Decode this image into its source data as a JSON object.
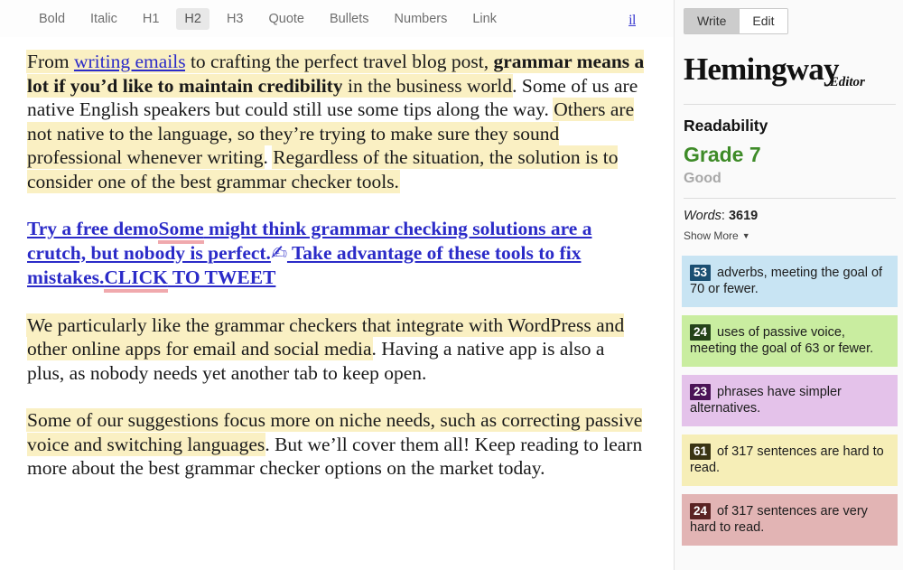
{
  "toolbar": {
    "items": [
      {
        "label": "Bold",
        "active": false
      },
      {
        "label": "Italic",
        "active": false
      },
      {
        "label": "H1",
        "active": false
      },
      {
        "label": "H2",
        "active": true
      },
      {
        "label": "H3",
        "active": false
      },
      {
        "label": "Quote",
        "active": false
      },
      {
        "label": "Bullets",
        "active": false
      },
      {
        "label": "Numbers",
        "active": false
      },
      {
        "label": "Link",
        "active": false
      }
    ],
    "chart_icon_label": "il"
  },
  "document": {
    "paragraph1": {
      "seg1": "From ",
      "link": "writing emails",
      "seg2": " to crafting the perfect travel blog post, ",
      "bold": "grammar means a lot if you’d like to maintain credibility",
      "seg3": " in the business world",
      "seg4": ". Some of us are native English speakers but could still use some tips along the way. ",
      "seg5": "Others are not native to the language, so they’re trying to make sure they sound professional whenever writing",
      "seg6": ". ",
      "seg7": "Regardless of the situation, the solution is to consider one of the best grammar checker tools.",
      "seg8": ""
    },
    "paragraph2": {
      "seg1": "Try a free demo",
      "seg2": "Some",
      "seg3": " might think grammar checking solutions are a crutch, but nobody is perfect.",
      "emoji": "✍",
      "seg4": " Take advantage of these tools to fix mistakes.",
      "seg5": "CLICK",
      "seg6": " TO TWEET"
    },
    "paragraph3": {
      "hl": "We particularly like the grammar checkers that integrate with WordPress and other online apps for email and social media",
      "rest": ". Having a native app is also a plus, as nobody needs yet another tab to keep open."
    },
    "paragraph4": {
      "hl": "Some of our suggestions focus more on niche needs, such as correcting passive voice and switching languages",
      "rest": ". But we’ll cover them all! Keep reading to learn more about the best grammar checker options on the market today."
    }
  },
  "sidebar": {
    "mode": {
      "write_label": "Write",
      "edit_label": "Edit",
      "selected": "Write"
    },
    "brand": {
      "name": "Hemingway",
      "sub": "Editor"
    },
    "readability": {
      "title": "Readability",
      "grade": "Grade 7",
      "note": "Good",
      "grade_color": "#3e8b28"
    },
    "words": {
      "label": "Words",
      "separator": ": ",
      "value": "3619"
    },
    "show_more": {
      "label": "Show More",
      "caret": "▼"
    },
    "stats": [
      {
        "count": "53",
        "text": " adverbs, meeting the goal of 70 or fewer.",
        "bg": "#c8e4f3",
        "badge_bg": "#1b4f72"
      },
      {
        "count": "24",
        "text": " uses of passive voice, meeting the goal of 63 or fewer.",
        "bg": "#c9eda0",
        "badge_bg": "#24431a"
      },
      {
        "count": "23",
        "text": " phrases have simpler alternatives.",
        "bg": "#e4c2ea",
        "badge_bg": "#4b1457"
      },
      {
        "count": "61",
        "text": " of 317 sentences are hard to read.",
        "bg": "#f6eeb7",
        "badge_bg": "#3a3413"
      },
      {
        "count": "24",
        "text": " of 317 sentences are very hard to read.",
        "bg": "#e2b4b4",
        "badge_bg": "#5a2323"
      }
    ]
  }
}
